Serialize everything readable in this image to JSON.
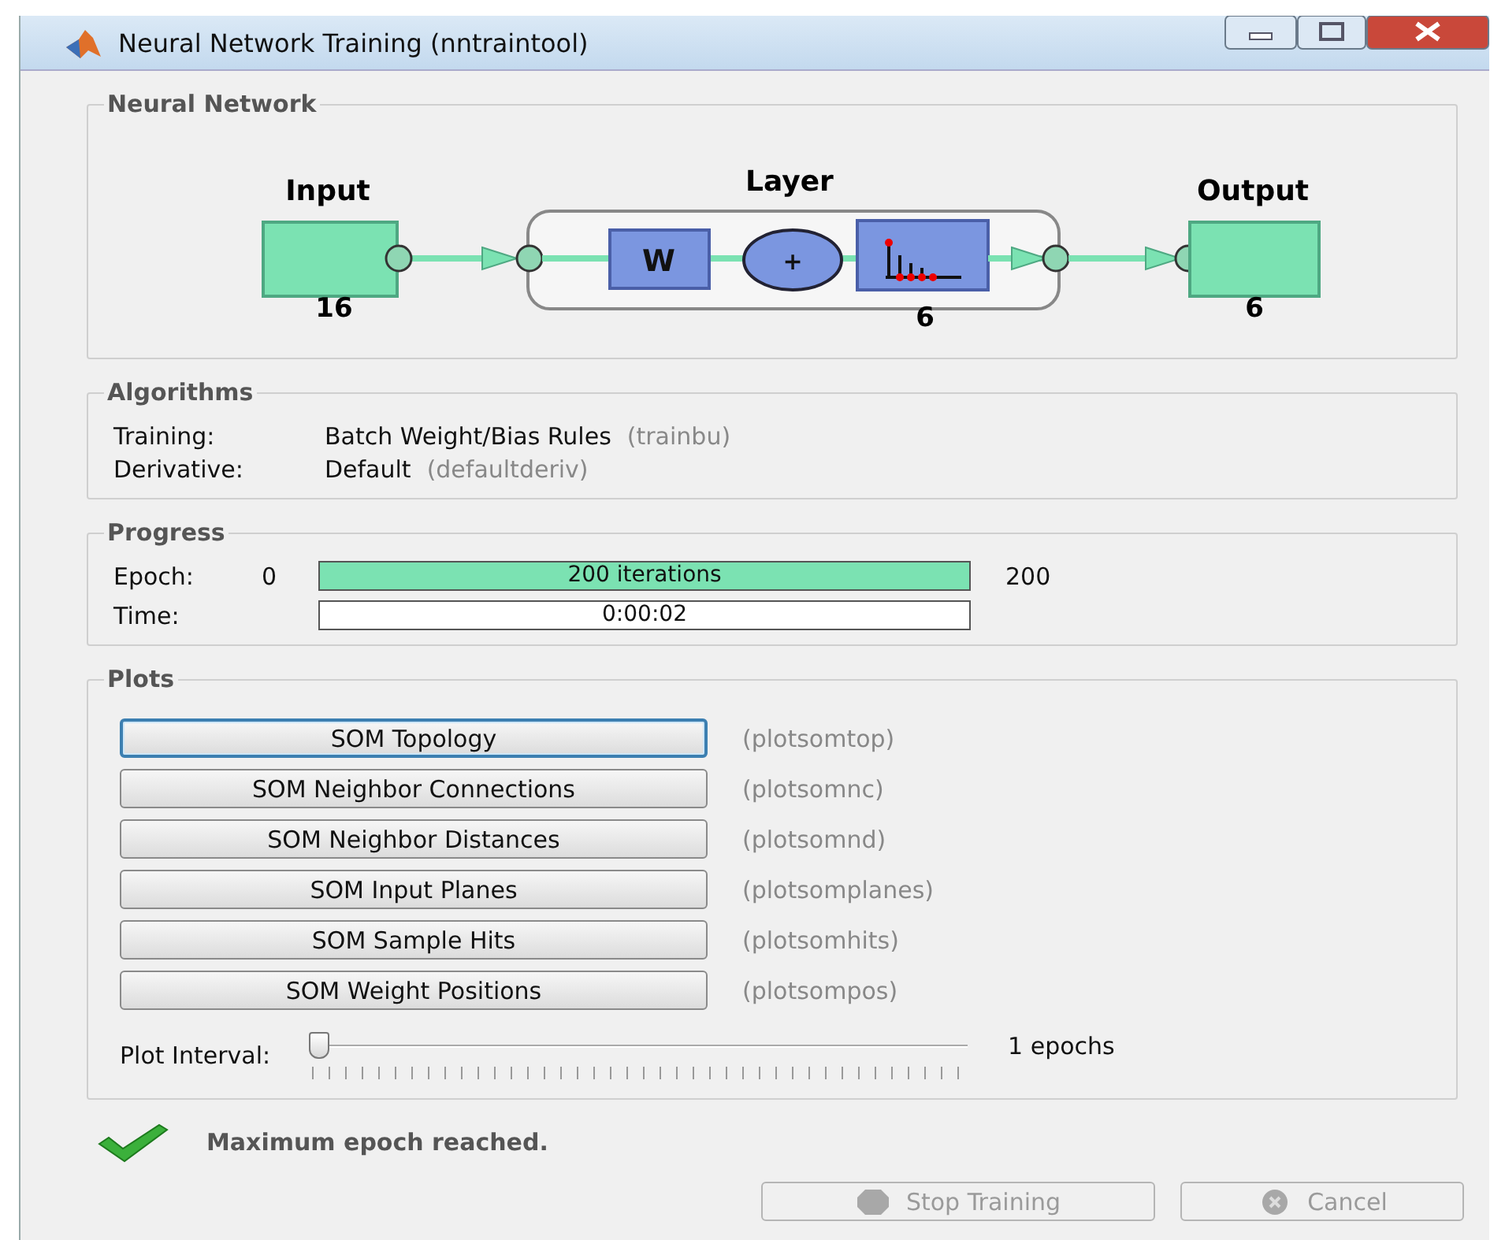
{
  "window": {
    "title": "Neural Network Training (nntraintool)"
  },
  "network": {
    "title": "Neural Network",
    "input": {
      "label": "Input",
      "size": "16"
    },
    "layer": {
      "label": "Layer",
      "size": "6",
      "weight": "W",
      "sum": "+"
    },
    "output": {
      "label": "Output",
      "size": "6"
    }
  },
  "algorithms": {
    "title": "Algorithms",
    "rows": [
      {
        "label": "Training:",
        "value": "Batch Weight/Bias Rules",
        "function": "(trainbu)"
      },
      {
        "label": "Derivative:",
        "value": "Default",
        "function": "(defaultderiv)"
      }
    ]
  },
  "progress": {
    "title": "Progress",
    "rows": [
      {
        "label": "Epoch:",
        "start": "0",
        "bar_text": "200 iterations",
        "level": 1,
        "end": "200"
      },
      {
        "label": "Time:",
        "bar_text": "0:00:02"
      }
    ]
  },
  "plots": {
    "title": "Plots",
    "buttons": [
      {
        "label": "SOM Topology",
        "function": "(plotsomtop)",
        "selected": true
      },
      {
        "label": "SOM Neighbor Connections",
        "function": "(plotsomnc)",
        "selected": false
      },
      {
        "label": "SOM Neighbor Distances",
        "function": "(plotsomnd)",
        "selected": false
      },
      {
        "label": "SOM Input Planes",
        "function": "(plotsomplanes)",
        "selected": false
      },
      {
        "label": "SOM Sample Hits",
        "function": "(plotsomhits)",
        "selected": false
      },
      {
        "label": "SOM Weight Positions",
        "function": "(plotsompos)",
        "selected": false
      }
    ],
    "interval": {
      "label": "Plot Interval:",
      "level": 0,
      "reading": "1 epochs"
    }
  },
  "status": {
    "message": "Maximum epoch reached."
  },
  "buttons": [
    {
      "kind": "stop",
      "label": "Stop Training",
      "disabled": true
    },
    {
      "kind": "cancel",
      "label": "Cancel",
      "disabled": true
    }
  ]
}
